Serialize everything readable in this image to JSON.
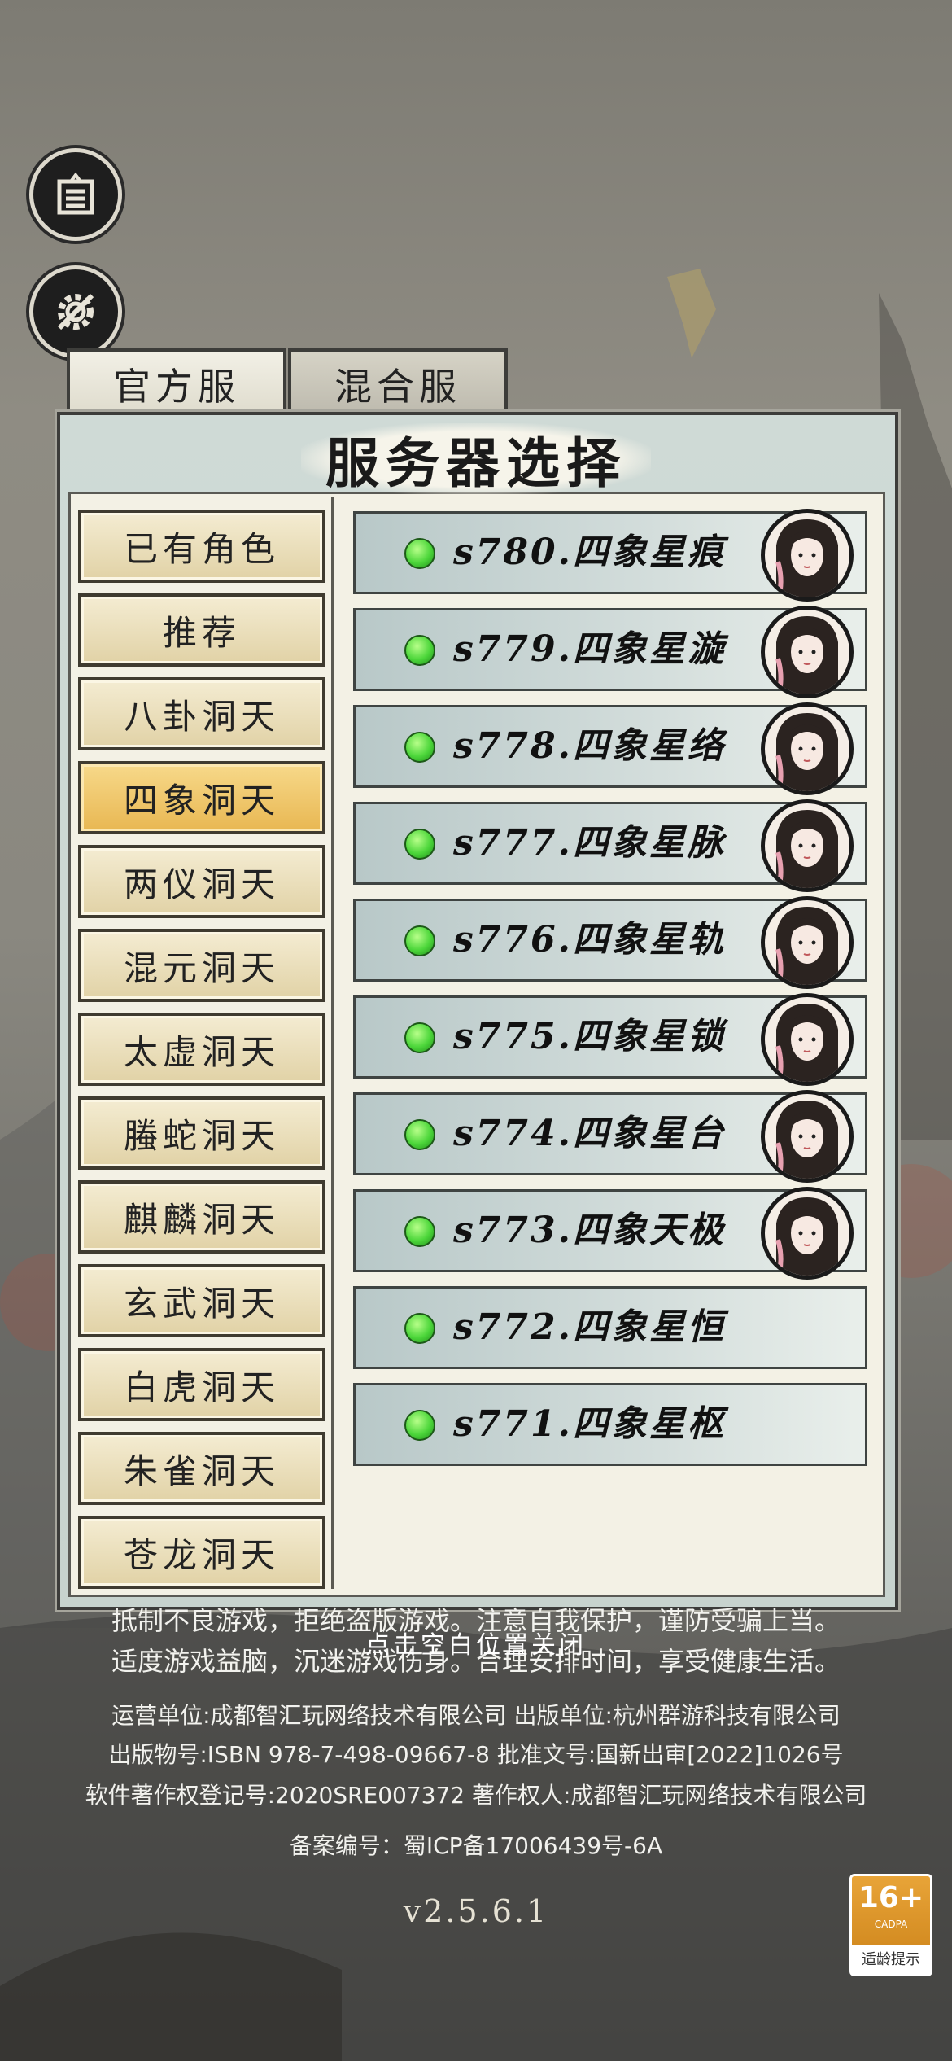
{
  "top_buttons": {
    "notice_icon": "notice-board-icon",
    "settings_icon": "gear-wrench-icon"
  },
  "tabs": [
    {
      "label": "官方服"
    },
    {
      "label": "混合服"
    }
  ],
  "panel": {
    "title": "服务器选择"
  },
  "categories": [
    {
      "label": "已有角色"
    },
    {
      "label": "推荐"
    },
    {
      "label": "八卦洞天"
    },
    {
      "label": "四象洞天",
      "active": true
    },
    {
      "label": "两仪洞天"
    },
    {
      "label": "混元洞天"
    },
    {
      "label": "太虚洞天"
    },
    {
      "label": "螣蛇洞天"
    },
    {
      "label": "麒麟洞天"
    },
    {
      "label": "玄武洞天"
    },
    {
      "label": "白虎洞天"
    },
    {
      "label": "朱雀洞天"
    },
    {
      "label": "苍龙洞天"
    }
  ],
  "servers": [
    {
      "name": "s780.四象星痕",
      "has_avatar": true
    },
    {
      "name": "s779.四象星漩",
      "has_avatar": true
    },
    {
      "name": "s778.四象星络",
      "has_avatar": true
    },
    {
      "name": "s777.四象星脉",
      "has_avatar": true
    },
    {
      "name": "s776.四象星轨",
      "has_avatar": true
    },
    {
      "name": "s775.四象星锁",
      "has_avatar": true
    },
    {
      "name": "s774.四象星台",
      "has_avatar": true
    },
    {
      "name": "s773.四象天极",
      "has_avatar": true
    },
    {
      "name": "s772.四象星恒",
      "has_avatar": false
    },
    {
      "name": "s771.四象星枢",
      "has_avatar": false
    }
  ],
  "status_color": "#4cd63a",
  "footer": {
    "notice_line1": "抵制不良游戏，拒绝盗版游戏。注意自我保护，谨防受骗上当。",
    "notice_line2": "适度游戏益脑，沉迷游戏伤身。合理安排时间，享受健康生活。",
    "close_hint": "点击空白位置关闭",
    "operator": "运营单位:成都智汇玩网络技术有限公司  出版单位:杭州群游科技有限公司",
    "isbn": "出版物号:ISBN 978-7-498-09667-8  批准文号:国新出审[2022]1026号",
    "copyright": "软件著作权登记号:2020SRE007372  著作权人:成都智汇玩网络技术有限公司",
    "icp": "备案编号：蜀ICP备17006439号-6A",
    "version": "v2.5.6.1"
  },
  "age_rating": {
    "age": "16+",
    "org": "CADPA",
    "label": "适龄提示"
  }
}
